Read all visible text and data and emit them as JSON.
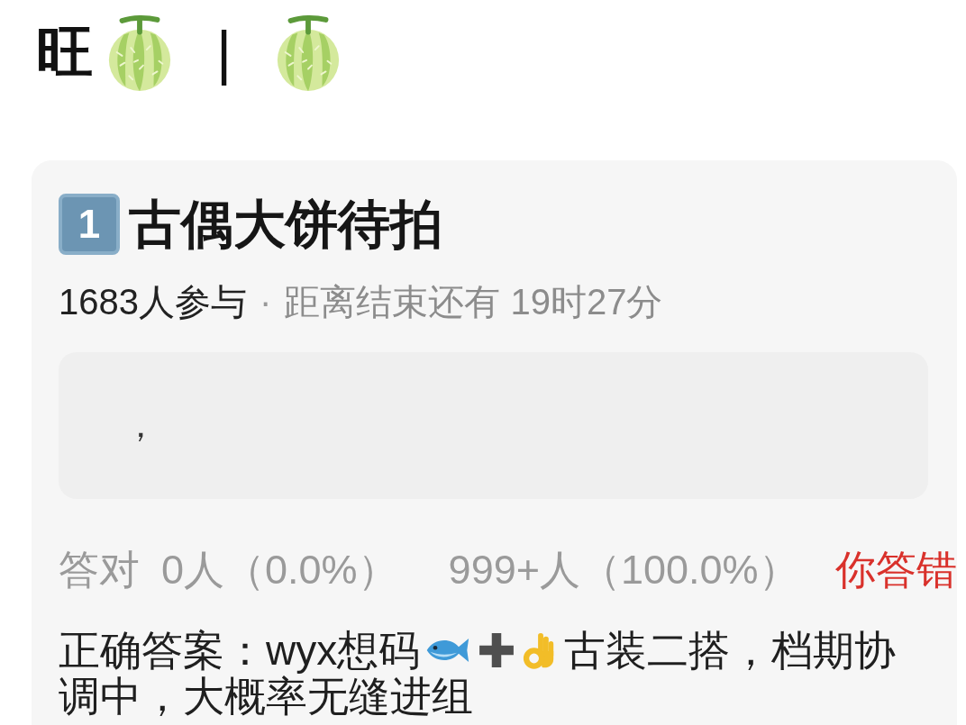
{
  "header": {
    "text": "旺",
    "separator": "|"
  },
  "quiz": {
    "number": "1",
    "title": "古偶大饼待拍",
    "participants": "1683人参与",
    "separator": "·",
    "countdown": "距离结束还有 19时27分",
    "your_answer": "，",
    "stats": {
      "correct_label": "答对",
      "correct_value": "0人（0.0%）",
      "wrong_value": "999+人（100.0%）",
      "verdict": {
        "text": "你答错",
        "correct": false
      }
    },
    "answer": {
      "lead": "正确答案：wyx想码",
      "line_1_rest": "古装二搭，档期协",
      "line_2": "调中，大概率无缝进组"
    }
  }
}
